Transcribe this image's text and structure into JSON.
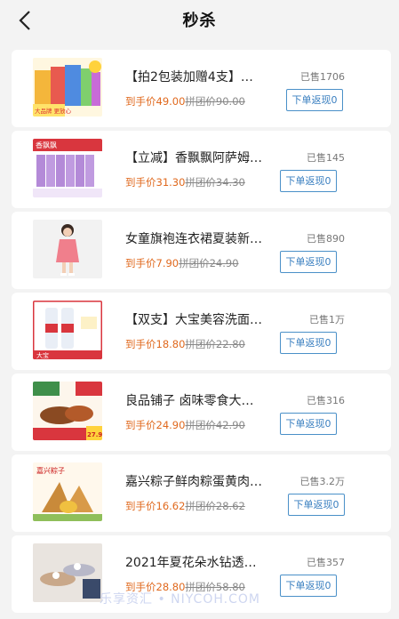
{
  "header": {
    "title": "秒杀",
    "back_icon": "chevron-left-icon"
  },
  "labels": {
    "price_prefix": "到手价",
    "orig_prefix": "拼团价",
    "sold_prefix": "已售",
    "button": "下单返现0"
  },
  "products": [
    {
      "name": "【拍2包装加赠4支】…",
      "sold": "已售1706",
      "price": "到手价49.00",
      "orig": "拼团价90.00",
      "button": "下单返现0",
      "thumb": "snack-box"
    },
    {
      "name": "【立减】香飘飘阿萨姆…",
      "sold": "已售145",
      "price": "到手价31.30",
      "orig": "拼团价34.30",
      "button": "下单返现0",
      "thumb": "milk-tea"
    },
    {
      "name": "女童旗袍连衣裙夏装新…",
      "sold": "已售890",
      "price": "到手价7.90",
      "orig": "拼团价24.90",
      "button": "下单返现0",
      "thumb": "girl-dress"
    },
    {
      "name": "【双支】大宝美容洗面…",
      "sold": "已售1万",
      "price": "到手价18.80",
      "orig": "拼团价22.80",
      "button": "下单返现0",
      "thumb": "cleanser"
    },
    {
      "name": "良品铺子 卤味零食大…",
      "sold": "已售316",
      "price": "到手价24.90",
      "orig": "拼团价42.90",
      "button": "下单返现0",
      "thumb": "braised-snacks"
    },
    {
      "name": "嘉兴粽子鲜肉粽蛋黄肉…",
      "sold": "已售3.2万",
      "price": "到手价16.62",
      "orig": "拼团价28.62",
      "button": "下单返现0",
      "thumb": "zongzi"
    },
    {
      "name": "2021年夏花朵水钻透…",
      "sold": "已售357",
      "price": "到手价28.80",
      "orig": "拼团价58.80",
      "button": "下单返现0",
      "thumb": "sandals"
    }
  ],
  "thumb_texts": {
    "snack-box": "大品牌 更放心",
    "milk-tea": "香飘飘",
    "cleanser": "大宝",
    "braised-snacks": "27.9",
    "zongzi": "嘉兴粽子"
  },
  "watermark": "乐享资汇 • NIYCOH.COM",
  "colors": {
    "accent_price": "#e0691e",
    "button_border": "#4a90c8",
    "page_bg": "#f3f3f3"
  }
}
